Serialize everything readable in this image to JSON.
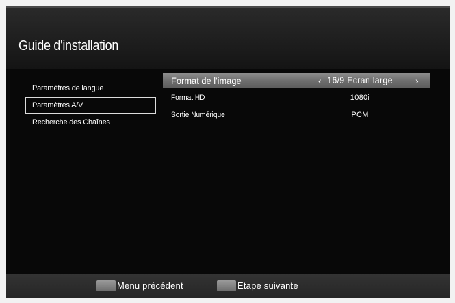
{
  "header": {
    "title": "Guide d'installation"
  },
  "sidebar": {
    "items": [
      {
        "label": "Paramètres de langue"
      },
      {
        "label": "Paramètres A/V"
      },
      {
        "label": "Recherche des Chaînes"
      }
    ]
  },
  "settings": {
    "rows": [
      {
        "label": "Format de l'image",
        "value": "16/9 Ecran large"
      },
      {
        "label": "Format HD",
        "value": "1080i"
      },
      {
        "label": "Sortie Numérique",
        "value": "PCM"
      }
    ]
  },
  "icons": {
    "prev_arrow": "chevron-left-icon",
    "next_arrow": "chevron-right-icon"
  },
  "footer": {
    "back_label": "Menu précédent",
    "next_label": "Etape suivante"
  },
  "colors": {
    "background": "#0c0c0c",
    "highlight": "#7a7a7a",
    "text": "#ffffff"
  }
}
